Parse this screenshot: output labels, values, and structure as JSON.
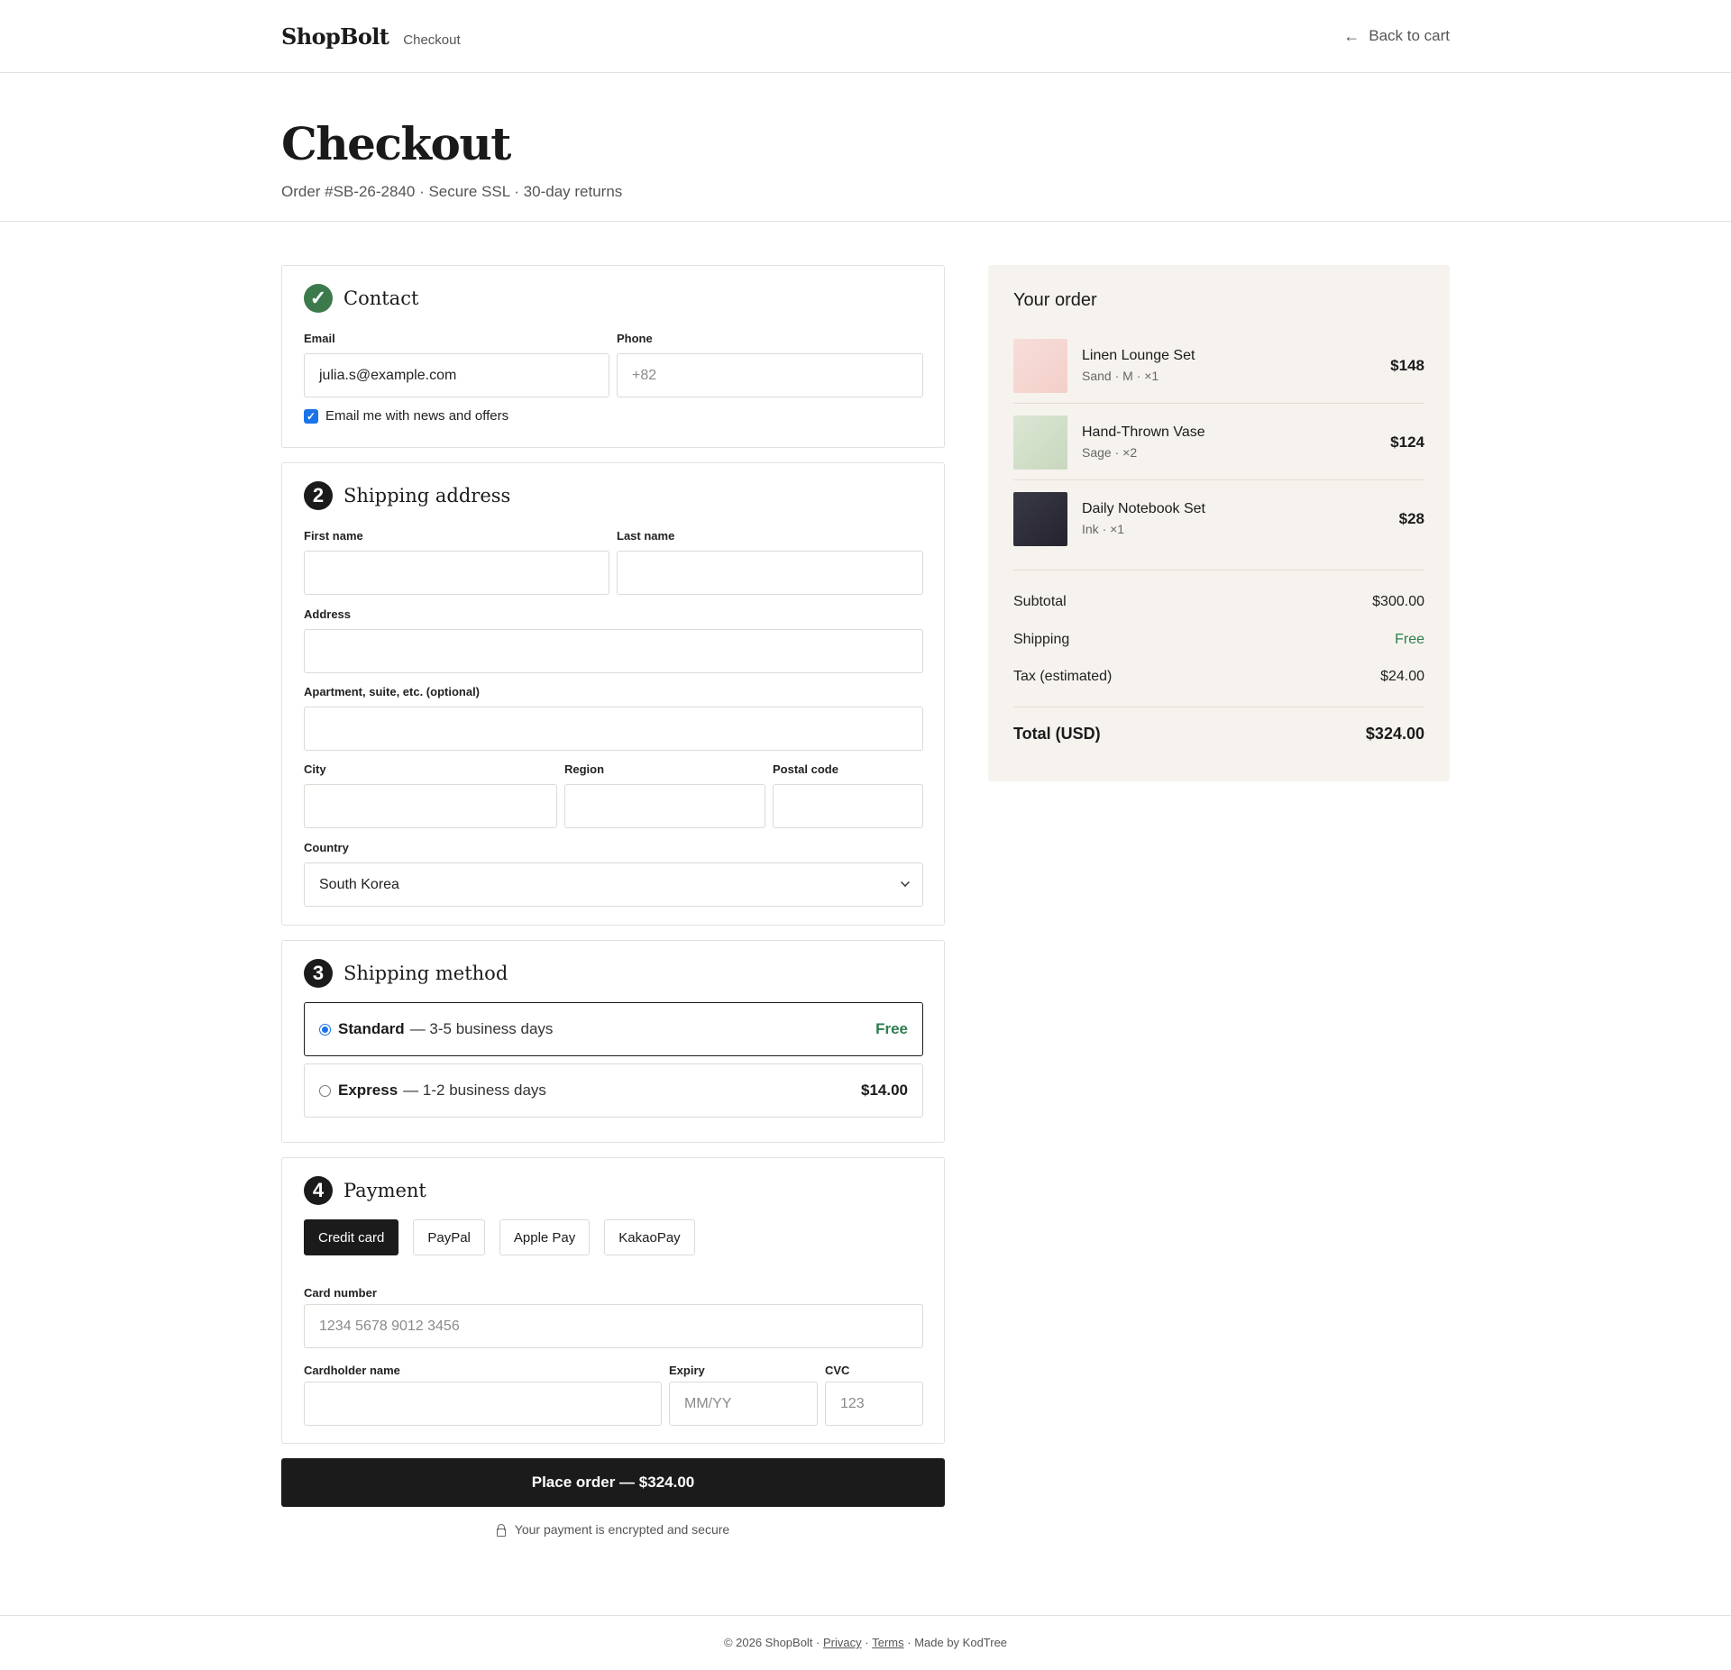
{
  "header": {
    "logo": "ShopBolt",
    "subtitle": "Checkout",
    "back_label": "Back to cart"
  },
  "hero": {
    "title": "Checkout",
    "meta": "Order #SB-26-2840 · Secure SSL · 30-day returns"
  },
  "contact": {
    "step": "✓",
    "title": "Contact",
    "email_label": "Email",
    "email_value": "julia.s@example.com",
    "phone_label": "Phone",
    "phone_placeholder": "+82",
    "newsletter_label": "Email me with news and offers",
    "newsletter_checked": true
  },
  "shipping_address": {
    "step": "2",
    "title": "Shipping address",
    "first_name_label": "First name",
    "last_name_label": "Last name",
    "address_label": "Address",
    "apartment_label": "Apartment, suite, etc. (optional)",
    "city_label": "City",
    "region_label": "Region",
    "postal_label": "Postal code",
    "country_label": "Country",
    "country_value": "South Korea"
  },
  "shipping_method": {
    "step": "3",
    "title": "Shipping method",
    "options": [
      {
        "name": "Standard",
        "detail": "— 3-5 business days",
        "price": "Free",
        "selected": true
      },
      {
        "name": "Express",
        "detail": "— 1-2 business days",
        "price": "$14.00",
        "selected": false
      }
    ]
  },
  "payment": {
    "step": "4",
    "title": "Payment",
    "tabs": [
      "Credit card",
      "PayPal",
      "Apple Pay",
      "KakaoPay"
    ],
    "active_tab": "Credit card",
    "card_number_label": "Card number",
    "card_number_placeholder": "1234 5678 9012 3456",
    "cardholder_label": "Cardholder name",
    "expiry_label": "Expiry",
    "expiry_placeholder": "MM/YY",
    "cvc_label": "CVC",
    "cvc_placeholder": "123"
  },
  "place_order": {
    "label": "Place order — $324.00",
    "secure_note": "Your payment is encrypted and secure"
  },
  "order_summary": {
    "title": "Your order",
    "items": [
      {
        "name": "Linen Lounge Set",
        "variant": "Sand · M · ×1",
        "price": "$148",
        "color": "#f6d9d5"
      },
      {
        "name": "Hand-Thrown Vase",
        "variant": "Sage · ×2",
        "price": "$124",
        "color": "#d3dfcb"
      },
      {
        "name": "Daily Notebook Set",
        "variant": "Ink · ×1",
        "price": "$28",
        "color": "#2e2d3a"
      }
    ],
    "subtotal_label": "Subtotal",
    "subtotal_value": "$300.00",
    "shipping_label": "Shipping",
    "shipping_value": "Free",
    "tax_label": "Tax (estimated)",
    "tax_value": "$24.00",
    "total_label": "Total (USD)",
    "total_value": "$324.00"
  },
  "footer": {
    "copyright": "© 2026 ShopBolt ·",
    "privacy": "Privacy",
    "sep": "·",
    "terms": "Terms",
    "made_by": "· Made by KodTree"
  },
  "colors": {
    "accent": "#1b1b1b",
    "success": "#2e7d4f",
    "checkbox": "#1a73e8",
    "summary_bg": "#f6f3ee"
  }
}
